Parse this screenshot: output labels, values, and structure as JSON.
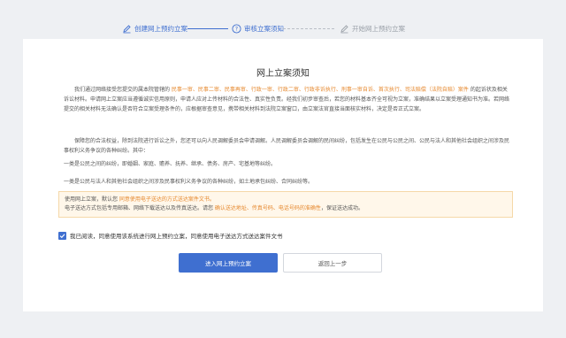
{
  "steps": [
    {
      "label": "创建网上预约立案",
      "icon": "edit-icon",
      "state": "done"
    },
    {
      "label": "审核立案须知",
      "icon": "help-circle-icon",
      "state": "active"
    },
    {
      "label": "开始网上预约立案",
      "icon": "edit-icon",
      "state": "pending"
    }
  ],
  "notice": {
    "title": "网上立案须知",
    "p1_a": "我们通过网络接受您提交的属本院管辖的 ",
    "p1_hl": "民事一审、民事二审、民事再审、行政一审、行政二审、行政非诉执行、刑事一审自诉、首次执行、司法赔偿（法院自赔）案件",
    "p1_b": " 的起诉状及相关诉讼材料。申请网上立案应当遵循诚实信用原则，申请人应对上传材料的合法性、真实性负责。经我们初步审查后，若您的材料基本齐全可视为立案，准确结果以立案受理通知书为准。若网络提交的相关材料无法确认是否符合立案受理条件的，应根据审查意见，携带相关材料到法院立案窗口，由立案法官直接当面核实材料，决定是否正式立案。",
    "p2": "保障您的合法权益，除到法院进行诉讼之外，您还可以向人民调解委员会申请调解。人民调解委员会调解的民间纠纷，包括发生在公民与公民之间、公民与法人和其他社会组织之间涉及民事权利义务争议的各种纠纷。其中：",
    "p3": "一类是公民之间的纠纷，即婚姻、家庭、赡养、抚养、继承、债务、房产、宅基地等纠纷。",
    "p4": "一类是公民与法人和其他社会组织之间涉及民事权利义务争议的各种纠纷，如土地承包纠纷、合同纠纷等。",
    "box_line1_a": "使用网上立案，默认您 ",
    "box_line1_hl": "同意使用电子送达的方式送达案件文书。",
    "box_line2_a": "电子送达方式包括专用邮箱、网络下载送达以及传真送达。请您 ",
    "box_line2_hl": "确认送达地址、传真号码、电话号码的准确性",
    "box_line2_b": "，保证送达成功。"
  },
  "agree": {
    "checked": true,
    "label": "我已阅读，同意使用该系统进行网上预约立案，同意使用电子送达方式送达案件文书"
  },
  "buttons": {
    "enter": "进入网上预约立案",
    "back": "返回上一步"
  },
  "colors": {
    "accent": "#3f6fd0",
    "highlight": "#e6892f",
    "notice_bg": "#fff7ea"
  }
}
